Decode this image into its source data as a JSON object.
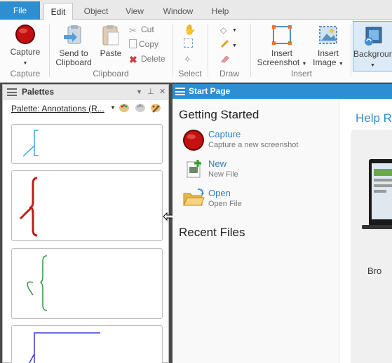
{
  "menu": {
    "tabs": [
      "File",
      "Edit",
      "Object",
      "View",
      "Window",
      "Help"
    ],
    "active_tab": "Edit"
  },
  "ribbon": {
    "capture": {
      "label": "Capture",
      "group": "Capture"
    },
    "clipboard": {
      "send_to_clipboard": [
        "Send to",
        "Clipboard"
      ],
      "paste": "Paste",
      "cut": "Cut",
      "copy": "Copy",
      "delete": "Delete",
      "group": "Clipboard"
    },
    "select": {
      "group": "Select"
    },
    "draw": {
      "group": "Draw"
    },
    "insert": {
      "screenshot": [
        "Insert",
        "Screenshot"
      ],
      "image": [
        "Insert",
        "Image"
      ],
      "group": "Insert"
    },
    "background": {
      "label": "Backgroun"
    }
  },
  "palettes": {
    "title": "Palettes",
    "selected": "Palette: Annotations (R...",
    "header_controls": [
      "▾",
      "📌",
      "✕"
    ]
  },
  "start_page": {
    "title": "Start Page",
    "getting_started": "Getting Started",
    "items": [
      {
        "title": "Capture",
        "desc": "Capture a new screenshot"
      },
      {
        "title": "New",
        "desc": "New File"
      },
      {
        "title": "Open",
        "desc": "Open File"
      }
    ],
    "recent_files": "Recent Files",
    "help_title": "Help Re",
    "promo_label": "Bro"
  },
  "colors": {
    "accent": "#2e8ecf",
    "capture_red": "#b80d0d",
    "annotation_1": "#3fa8d8",
    "annotation_2": "#c41a1a",
    "annotation_3": "#2e9a3e",
    "annotation_4": "#3a3ad0"
  }
}
